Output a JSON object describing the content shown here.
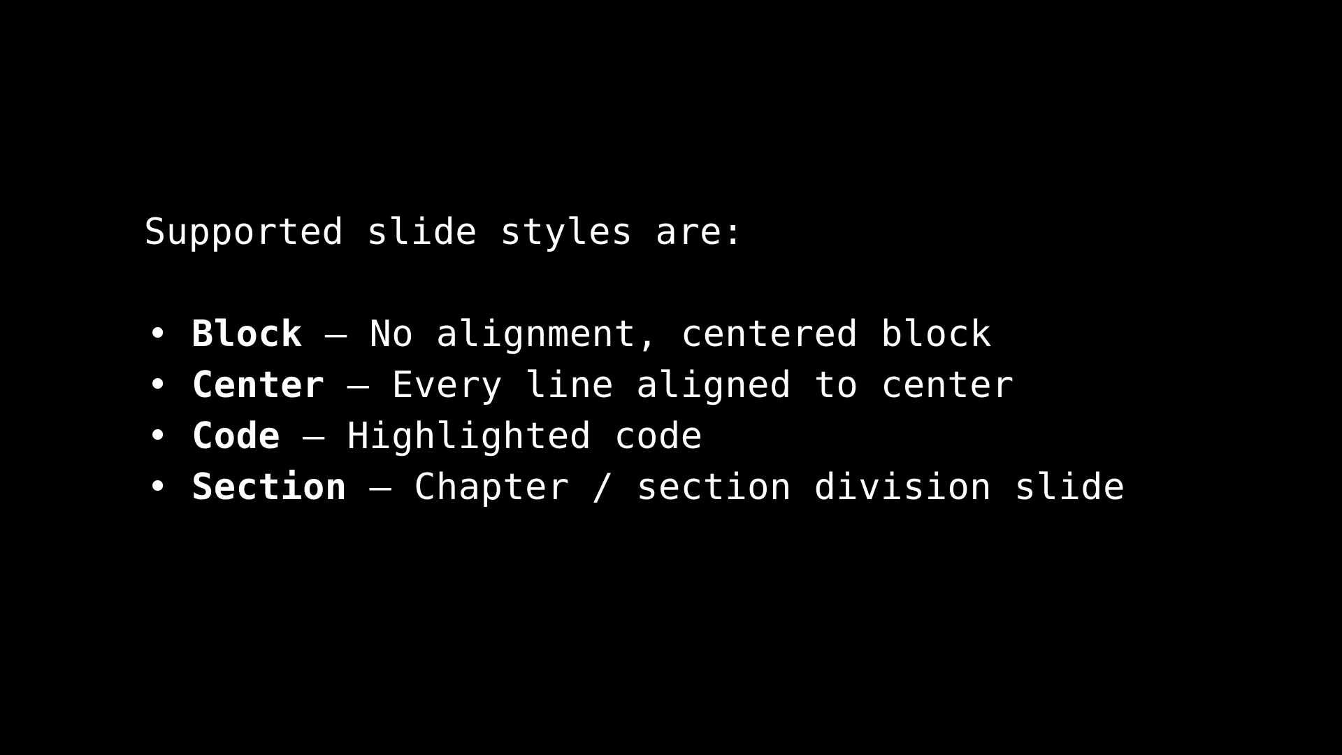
{
  "slide": {
    "background": "#000000",
    "text_color": "#ffffff",
    "intro": "Supported slide styles are:",
    "bullet_glyph": "•",
    "separator": " – ",
    "items": [
      {
        "name": "Block",
        "description": "No alignment, centered block"
      },
      {
        "name": "Center",
        "description": "Every line aligned to center"
      },
      {
        "name": "Code",
        "description": "Highlighted code"
      },
      {
        "name": "Section",
        "description": "Chapter / section division slide"
      }
    ]
  }
}
